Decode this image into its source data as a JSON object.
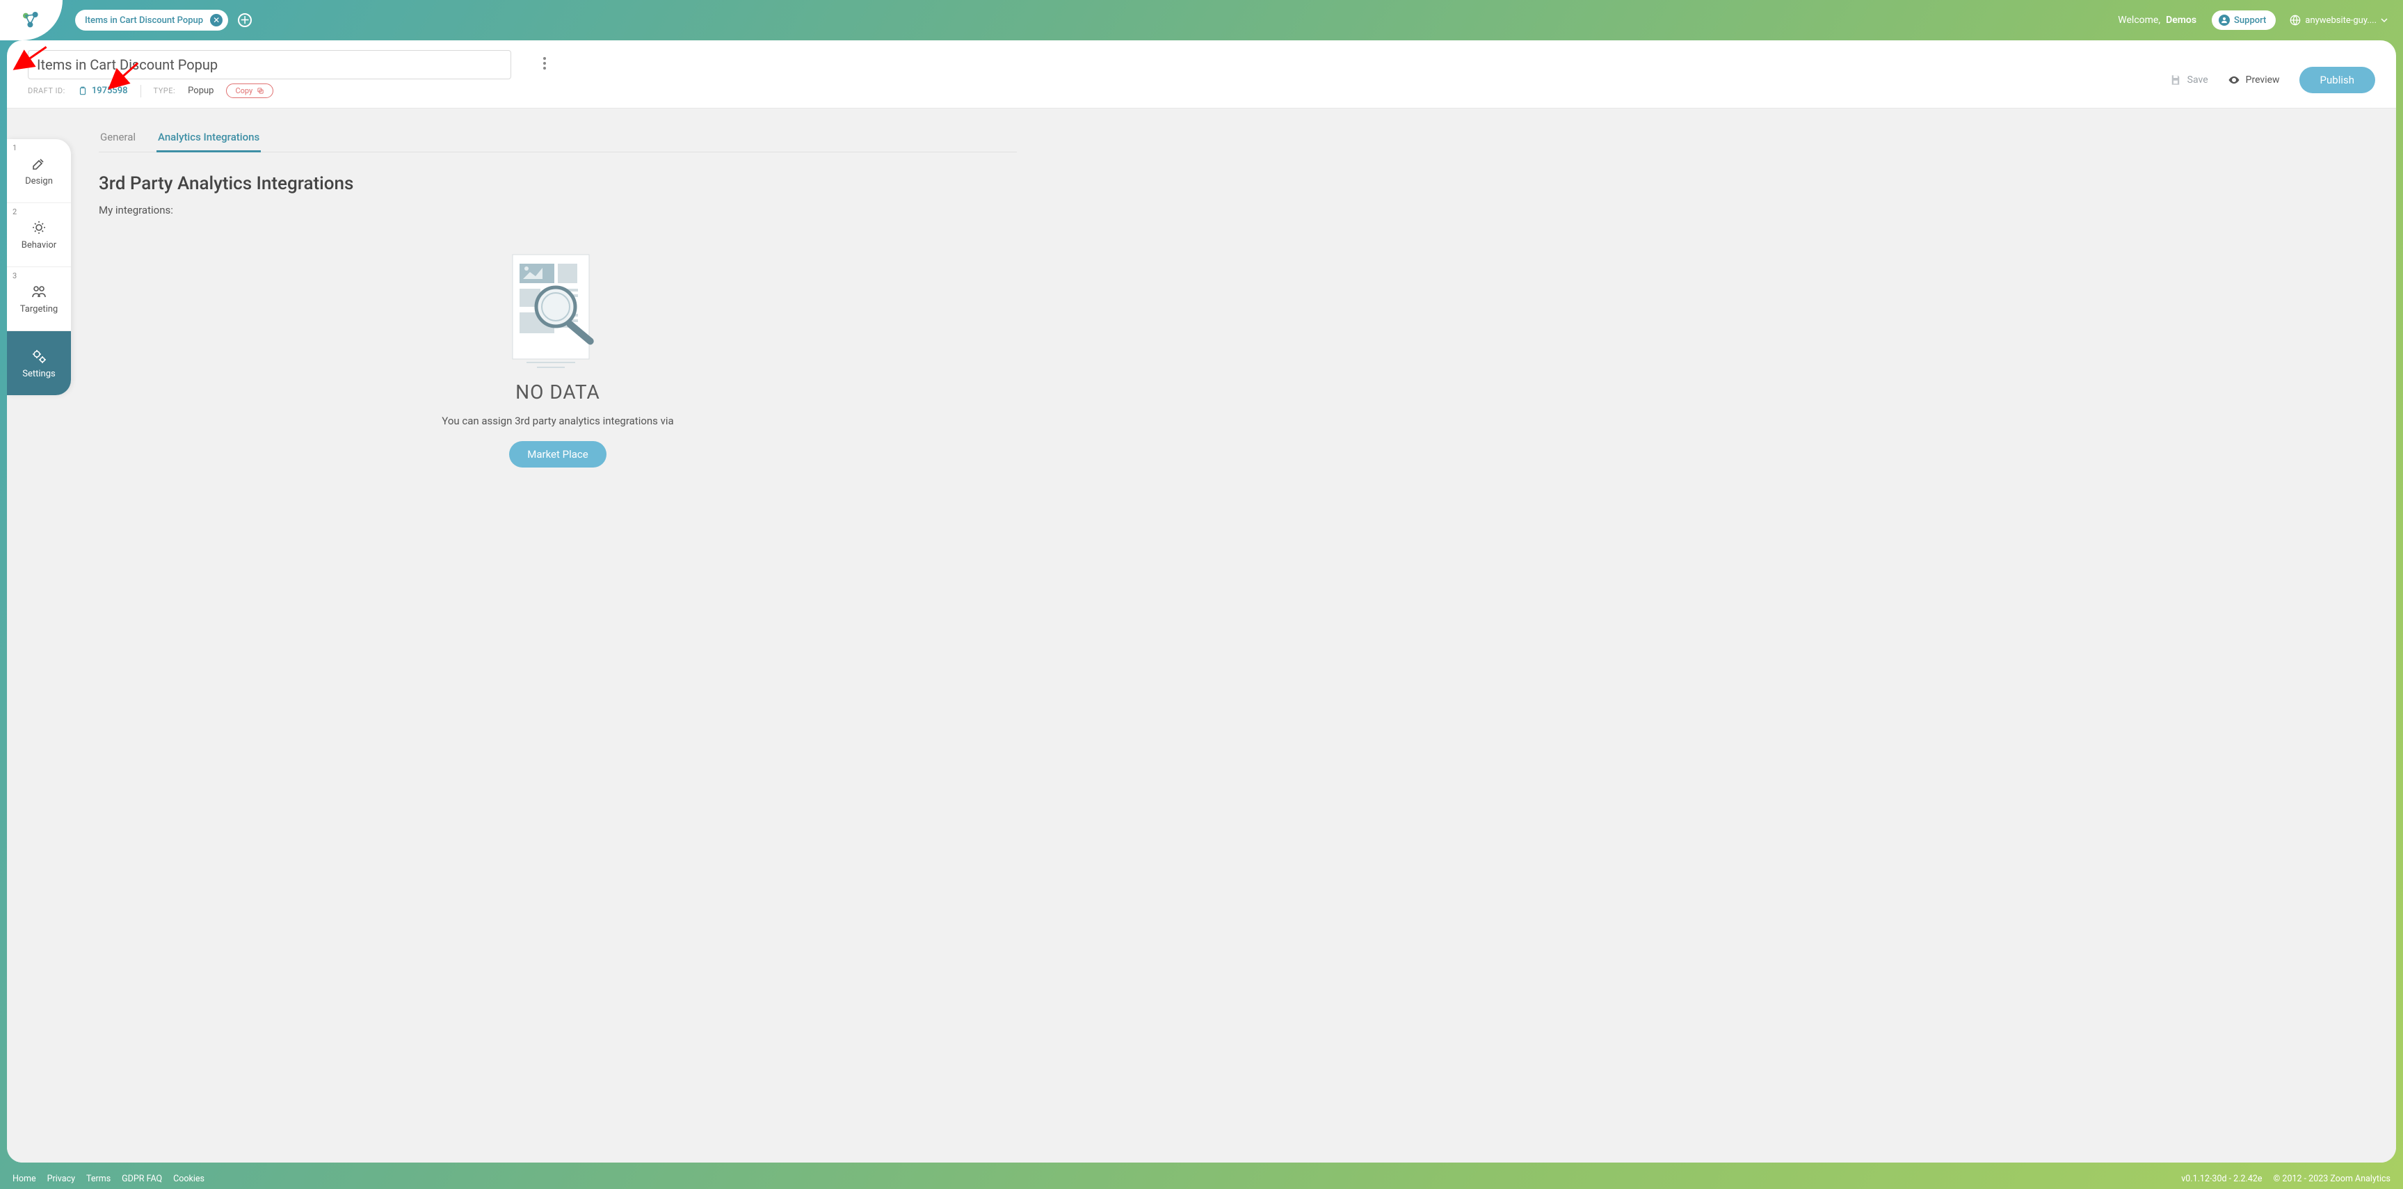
{
  "topbar": {
    "chip_label": "Items in Cart Discount Popup",
    "welcome_prefix": "Welcome,",
    "welcome_name": "Demos",
    "support_label": "Support",
    "user_label": "anywebsite-guy...."
  },
  "header": {
    "title_value": "Items in Cart Discount Popup",
    "draft_label": "DRAFT ID:",
    "draft_id": "1975598",
    "type_label": "TYPE:",
    "type_value": "Popup",
    "copy_label": "Copy",
    "save_label": "Save",
    "preview_label": "Preview",
    "publish_label": "Publish"
  },
  "stepper": {
    "items": [
      {
        "num": "1",
        "label": "Design"
      },
      {
        "num": "2",
        "label": "Behavior"
      },
      {
        "num": "3",
        "label": "Targeting"
      },
      {
        "num": "",
        "label": "Settings"
      }
    ]
  },
  "tabs": {
    "general": "General",
    "analytics": "Analytics Integrations"
  },
  "section": {
    "title": "3rd Party Analytics Integrations",
    "my_integrations": "My integrations:",
    "no_data_title": "NO DATA",
    "no_data_sub": "You can assign 3rd party analytics integrations via",
    "market_btn": "Market Place"
  },
  "footer": {
    "links": [
      "Home",
      "Privacy",
      "Terms",
      "GDPR FAQ",
      "Cookies"
    ],
    "version": "v0.1.12-30d - 2.2.42e",
    "copyright": "© 2012 - 2023 Zoom Analytics"
  }
}
